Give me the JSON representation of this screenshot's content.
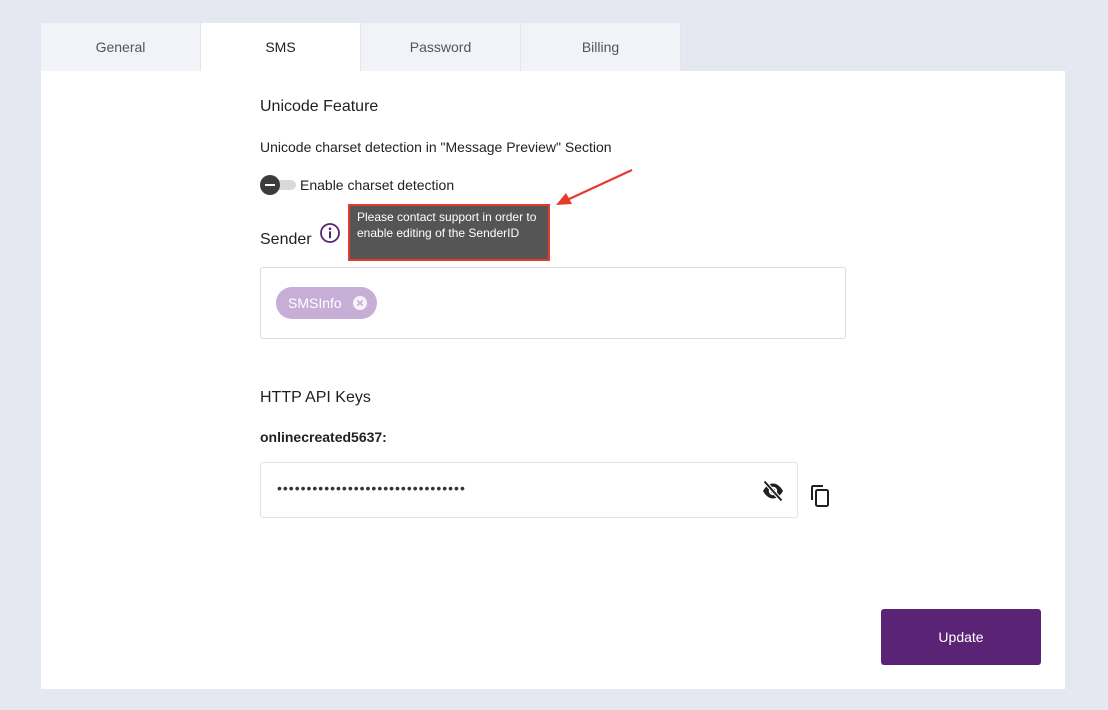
{
  "tabs": [
    {
      "label": "General",
      "active": false
    },
    {
      "label": "SMS",
      "active": true
    },
    {
      "label": "Password",
      "active": false
    },
    {
      "label": "Billing",
      "active": false
    }
  ],
  "unicode": {
    "title": "Unicode Feature",
    "description": "Unicode charset detection in \"Message Preview\" Section",
    "toggle_label": "Enable charset detection",
    "toggle_enabled": false
  },
  "sender": {
    "title": "Sender",
    "info_icon": "info-circle-icon",
    "tooltip": "Please contact support in order to enable editing of the SenderID",
    "chips": [
      {
        "label": "SMSInfo"
      }
    ]
  },
  "api_keys": {
    "title": "HTTP API Keys",
    "key_name": "onlinecreated5637:",
    "key_value_masked": "••••••••••••••••••••••••••••••••",
    "visibility_icon": "eye-off-icon",
    "copy_icon": "copy-icon"
  },
  "actions": {
    "update_label": "Update"
  },
  "colors": {
    "page_background": "#e6e8f1",
    "accent": "#5b2376",
    "chip": "#c7aed6",
    "tooltip_bg": "#555555",
    "annotation": "#e53a2c"
  }
}
